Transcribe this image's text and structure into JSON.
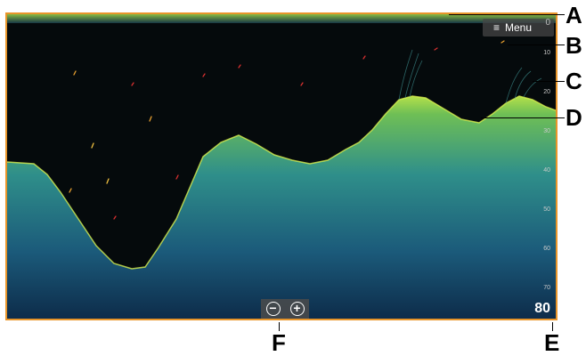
{
  "menu": {
    "label": "Menu"
  },
  "depth_scale": {
    "top_label": "0",
    "ticks": [
      "10",
      "20",
      "30",
      "40",
      "50",
      "60",
      "70"
    ],
    "range_label": "80"
  },
  "zoom": {
    "out_symbol": "−",
    "in_symbol": "+"
  },
  "callouts": {
    "a": "A",
    "b": "B",
    "c": "C",
    "d": "D",
    "e": "E",
    "f": "F"
  },
  "colors": {
    "frame": "#e8952a",
    "bottom": "#86c84a",
    "background": "#050a0c"
  }
}
